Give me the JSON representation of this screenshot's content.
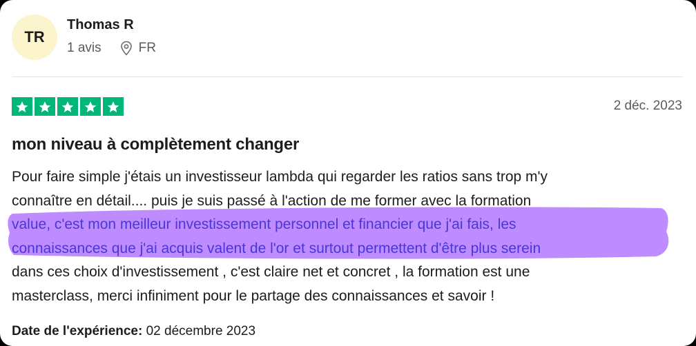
{
  "reviewer": {
    "initials": "TR",
    "name": "Thomas R",
    "review_count": "1 avis",
    "location_icon": "location-pin-icon",
    "country": "FR"
  },
  "review": {
    "rating": 5,
    "max_rating": 5,
    "star_color": "#00b67a",
    "date": "2 déc. 2023",
    "title": "mon niveau à complètement changer",
    "body_lines": [
      "Pour faire simple j'étais un investisseur lambda qui regarder les ratios sans trop m'y",
      "connaître en détail.... puis je suis passé à l'action de me former avec la formation",
      "value, c'est mon meilleur investissement personnel et financier que j'ai fais, les",
      "connaissances que j'ai acquis valent de l'or et surtout permettent d'être plus serein",
      "dans ces choix d'investissement , c'est claire net et concret , la formation est une",
      "masterclass, merci infiniment pour le partage des connaissances et savoir !"
    ],
    "highlight_color": "#bf8cff",
    "experience_label": "Date de l'expérience:",
    "experience_date": "02 décembre 2023"
  }
}
